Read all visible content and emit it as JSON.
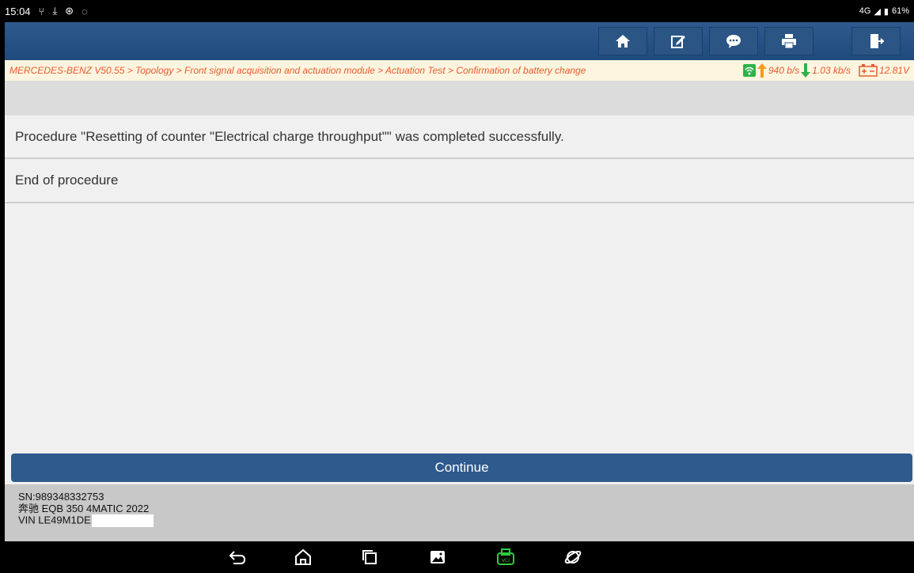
{
  "status_bar": {
    "time": "15:04",
    "network": "4G",
    "battery": "61%"
  },
  "toolbar": {
    "icons": [
      "home-icon",
      "edit-icon",
      "chat-icon",
      "print-icon",
      "exit-icon"
    ]
  },
  "breadcrumb": {
    "path": "MERCEDES-BENZ V50.55 > Topology > Front signal acquisition and actuation module > Actuation Test > Confirmation of battery change",
    "upload": "940 b/s",
    "download": "1.03 kb/s",
    "voltage": "12.81V"
  },
  "messages": [
    "Procedure \"Resetting of counter \"Electrical charge throughput\"\" was completed successfully.",
    "End of procedure"
  ],
  "continue_label": "Continue",
  "footer": {
    "sn": "SN:989348332753",
    "model": "奔驰 EQB 350 4MATIC 2022",
    "vin": "VIN LE49M1DE"
  },
  "colors": {
    "toolbar": "#2e5a8e",
    "breadcrumb_text": "#ea5a2f",
    "wifi_green": "#2db24a",
    "upload_orange": "#f59a23",
    "download_green": "#2db24a",
    "vci_green": "#2ecc40"
  }
}
